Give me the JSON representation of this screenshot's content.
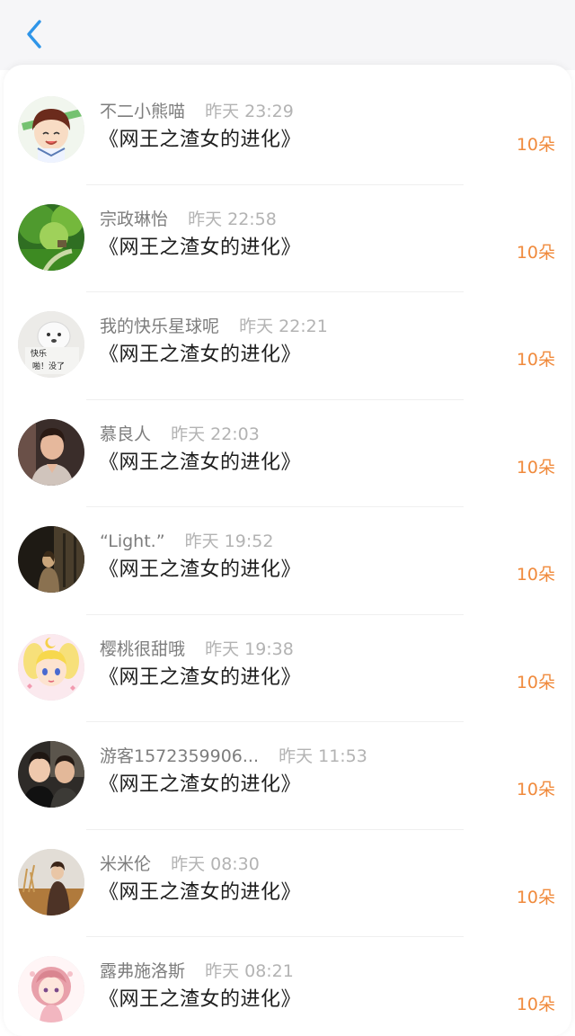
{
  "header": {
    "back_icon": "chevron-left-icon",
    "accent_color": "#2f95e8"
  },
  "list": {
    "amount_color": "#f08a3c",
    "items": [
      {
        "name": "不二小熊喵",
        "time": "昨天 23:29",
        "book": "《网王之渣女的进化》",
        "amount": "10朵",
        "avatar": "anime-boy-avatar"
      },
      {
        "name": "宗政琳怡",
        "time": "昨天 22:58",
        "book": "《网王之渣女的进化》",
        "amount": "10朵",
        "avatar": "forest-avatar"
      },
      {
        "name": "我的快乐星球呢",
        "time": "昨天 22:21",
        "book": "《网王之渣女的进化》",
        "amount": "10朵",
        "avatar": "dog-meme-avatar"
      },
      {
        "name": "慕良人",
        "time": "昨天 22:03",
        "book": "《网王之渣女的进化》",
        "amount": "10朵",
        "avatar": "man-portrait-avatar"
      },
      {
        "name": "“Light.”",
        "time": "昨天 19:52",
        "book": "《网王之渣女的进化》",
        "amount": "10朵",
        "avatar": "dark-figure-avatar"
      },
      {
        "name": "樱桃很甜哦",
        "time": "昨天 19:38",
        "book": "《网王之渣女的进化》",
        "amount": "10朵",
        "avatar": "sailor-moon-avatar"
      },
      {
        "name": "游客1572359906...",
        "time": "昨天 11:53",
        "book": "《网王之渣女的进化》",
        "amount": "10朵",
        "avatar": "two-men-avatar"
      },
      {
        "name": "米米伦",
        "time": "昨天 08:30",
        "book": "《网王之渣女的进化》",
        "amount": "10朵",
        "avatar": "field-figure-avatar"
      },
      {
        "name": "露弗施洛斯",
        "time": "昨天 08:21",
        "book": "《网王之渣女的进化》",
        "amount": "10朵",
        "avatar": "pink-anime-girl-avatar"
      }
    ]
  }
}
